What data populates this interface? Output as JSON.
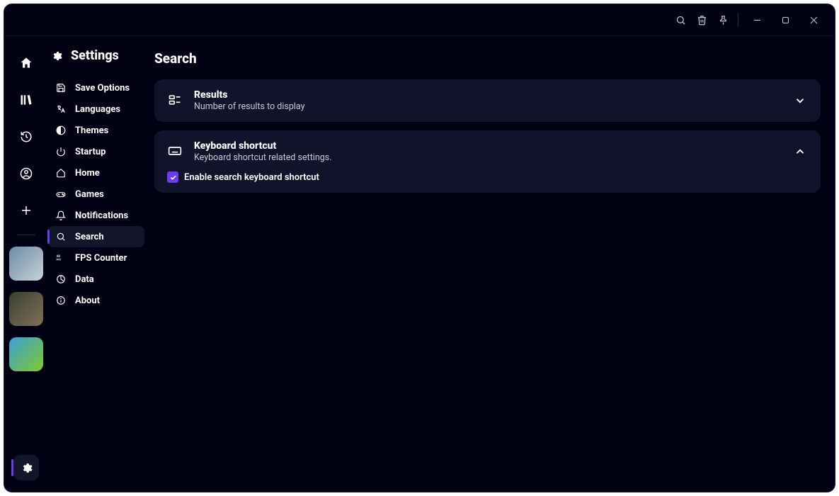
{
  "page_title": "Settings",
  "main_heading": "Search",
  "settings_nav": [
    {
      "id": "save-options",
      "label": "Save Options"
    },
    {
      "id": "languages",
      "label": "Languages"
    },
    {
      "id": "themes",
      "label": "Themes"
    },
    {
      "id": "startup",
      "label": "Startup"
    },
    {
      "id": "home",
      "label": "Home"
    },
    {
      "id": "games",
      "label": "Games"
    },
    {
      "id": "notifications",
      "label": "Notifications"
    },
    {
      "id": "search",
      "label": "Search",
      "active": true
    },
    {
      "id": "fps-counter",
      "label": "FPS Counter"
    },
    {
      "id": "data",
      "label": "Data"
    },
    {
      "id": "about",
      "label": "About"
    }
  ],
  "cards": {
    "results": {
      "title": "Results",
      "subtitle": "Number of results to display"
    },
    "keyboard": {
      "title": "Keyboard shortcut",
      "subtitle": "Keyboard shortcut related settings.",
      "checkbox_label": "Enable search keyboard shortcut",
      "checkbox_checked": true
    }
  }
}
